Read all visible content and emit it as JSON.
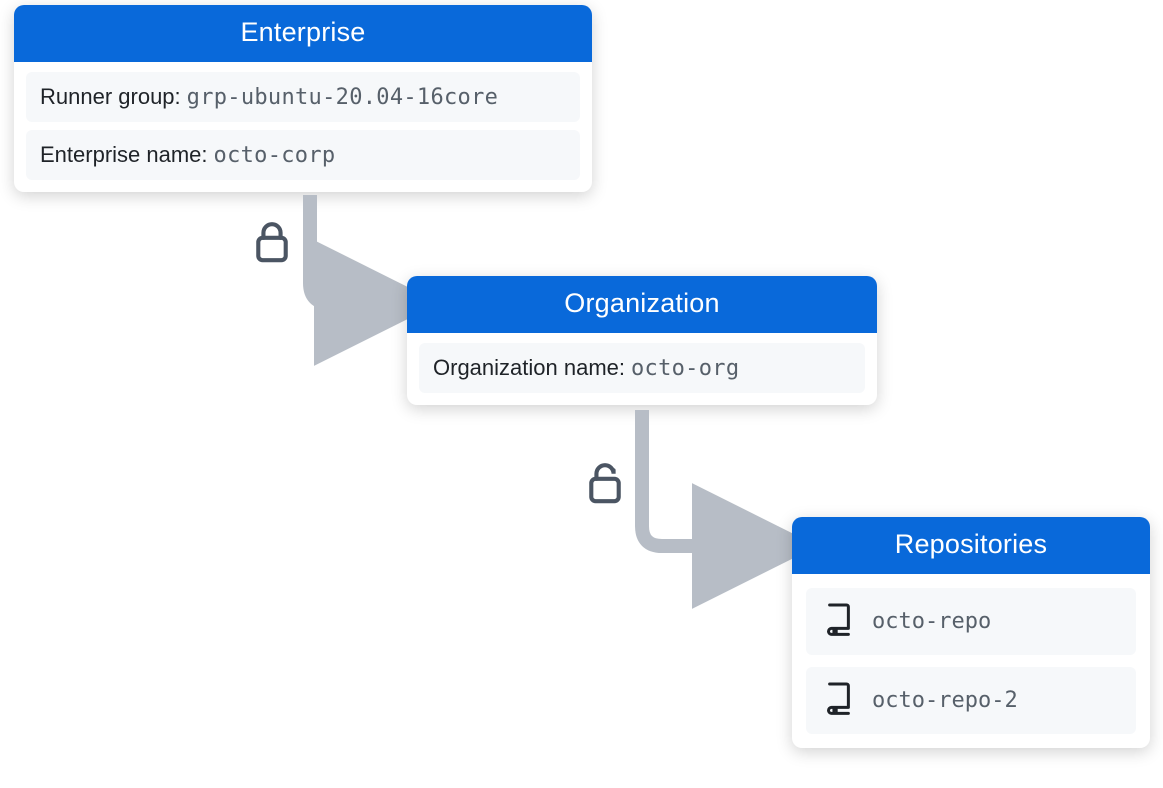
{
  "enterprise": {
    "title": "Enterprise",
    "runner_group_label": "Runner group:",
    "runner_group_value": "grp-ubuntu-20.04-16core",
    "name_label": "Enterprise name:",
    "name_value": "octo-corp"
  },
  "organization": {
    "title": "Organization",
    "name_label": "Organization name:",
    "name_value": "octo-org"
  },
  "repositories": {
    "title": "Repositories",
    "items": [
      {
        "name": "octo-repo"
      },
      {
        "name": "octo-repo-2"
      }
    ]
  },
  "colors": {
    "accent": "#0969DA",
    "mute": "#57606A",
    "bg_subtle": "#F6F8FA",
    "connector": "#B7BDC6",
    "lock": "#4B5563"
  }
}
